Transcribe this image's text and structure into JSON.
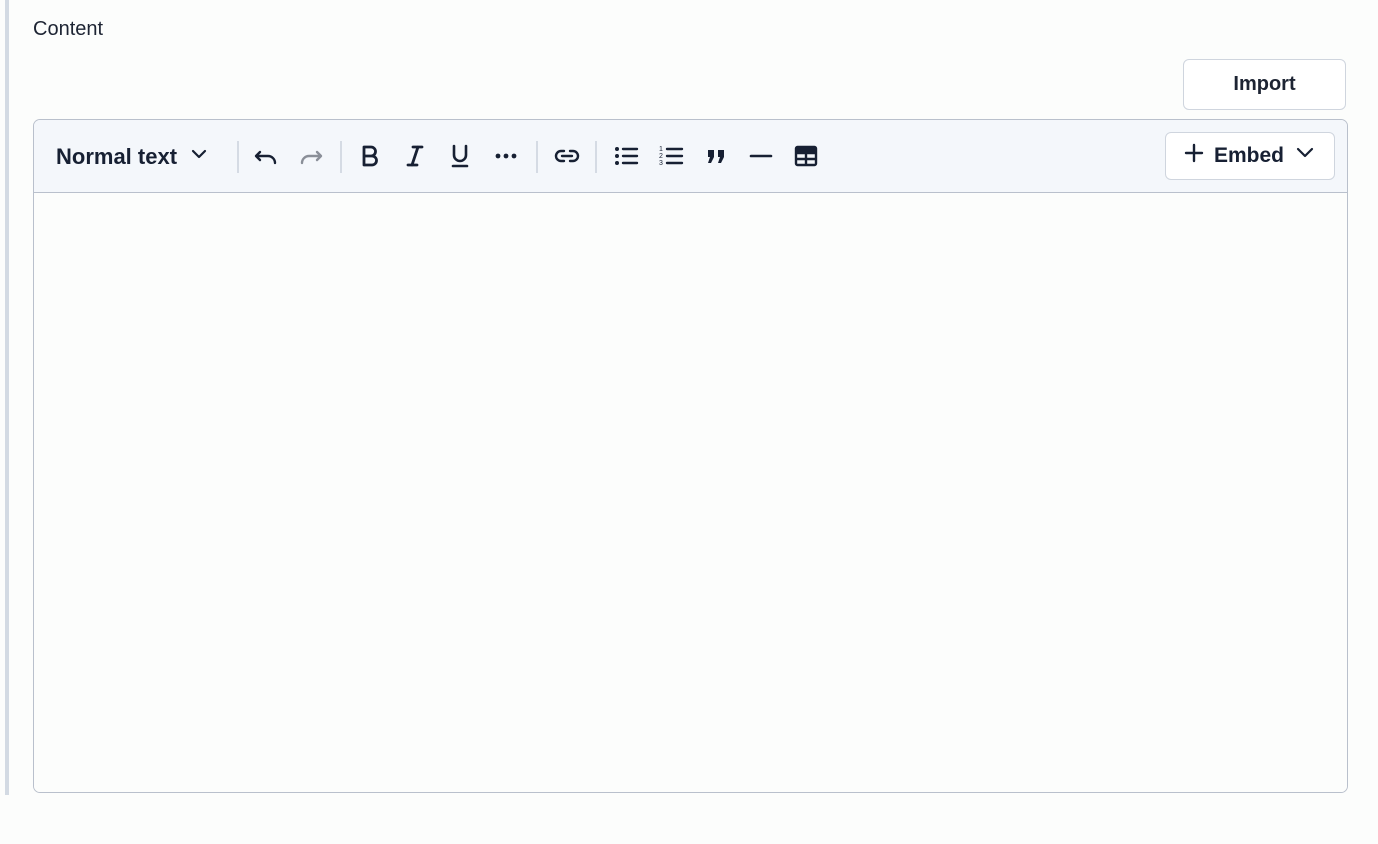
{
  "field": {
    "label": "Content"
  },
  "actions": {
    "import_label": "Import"
  },
  "toolbar": {
    "text_style": "Normal text",
    "embed_label": "Embed",
    "tools": [
      "undo-icon",
      "redo-icon",
      "bold-icon",
      "italic-icon",
      "underline-icon",
      "more-options-icon",
      "link-icon",
      "bulleted-list-icon",
      "numbered-list-icon",
      "blockquote-icon",
      "horizontal-rule-icon",
      "table-icon"
    ]
  },
  "editor": {
    "content": ""
  },
  "colors": {
    "text": "#172033",
    "toolbar_bg": "#f4f7fb",
    "border": "#b9c0cc",
    "disabled_icon": "#8a8f98"
  }
}
